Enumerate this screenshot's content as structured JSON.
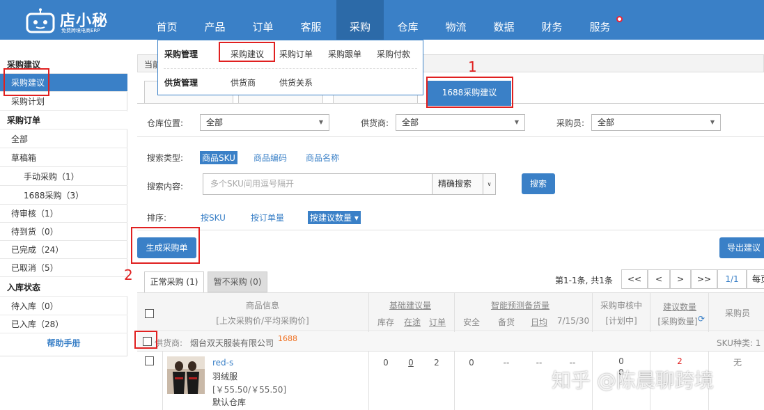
{
  "logo": {
    "brand": "店小秘",
    "tagline": "免费跨境电商ERP"
  },
  "nav": {
    "items": [
      "首页",
      "产品",
      "订单",
      "客服",
      "采购",
      "仓库",
      "物流",
      "数据",
      "财务",
      "服务"
    ],
    "active": "采购"
  },
  "dropdown": {
    "group1_title": "采购管理",
    "group1_items": [
      "采购建议",
      "采购订单",
      "采购跟单",
      "采购付款"
    ],
    "group2_title": "供货管理",
    "group2_items": [
      "供货商",
      "供货关系"
    ]
  },
  "sidebar": {
    "rows": [
      {
        "label": "采购建议",
        "type": "head"
      },
      {
        "label": "采购建议",
        "type": "item",
        "selected": true
      },
      {
        "label": "采购计划",
        "type": "item"
      },
      {
        "label": "采购订单",
        "type": "head"
      },
      {
        "label": "全部",
        "type": "item"
      },
      {
        "label": "草稿箱",
        "type": "item"
      },
      {
        "label": "手动采购（1）",
        "type": "sub"
      },
      {
        "label": "1688采购（3）",
        "type": "sub"
      },
      {
        "label": "待审核（1）",
        "type": "item"
      },
      {
        "label": "待到货（0）",
        "type": "item"
      },
      {
        "label": "已完成（24）",
        "type": "item"
      },
      {
        "label": "已取消（5）",
        "type": "item"
      },
      {
        "label": "入库状态",
        "type": "head"
      },
      {
        "label": "待入库（0）",
        "type": "item"
      },
      {
        "label": "已入库（28）",
        "type": "item"
      },
      {
        "label": "帮助手册",
        "type": "help"
      }
    ]
  },
  "breadcrumb": "当前",
  "tabs": {
    "active_label": "1688采购建议"
  },
  "filters": {
    "warehouse_label": "仓库位置:",
    "warehouse_value": "全部",
    "supplier_label": "供货商:",
    "supplier_value": "全部",
    "buyer_label": "采购员:",
    "buyer_value": "全部"
  },
  "search": {
    "type_label": "搜索类型:",
    "types": [
      "商品SKU",
      "商品编码",
      "商品名称"
    ],
    "active_type": "商品SKU",
    "content_label": "搜索内容:",
    "placeholder": "多个SKU间用逗号隔开",
    "mode": "精确搜索",
    "button": "搜索"
  },
  "sort": {
    "label": "排序:",
    "options": [
      "按SKU",
      "按订单量",
      "按建议数量 ▾"
    ]
  },
  "actions": {
    "generate": "生成采购单",
    "export": "导出建议"
  },
  "list_tabs": {
    "normal": "正常采购 (1)",
    "paused": "暂不采购 (0)"
  },
  "pager": {
    "info": "第1-1条, 共1条",
    "first": "<<",
    "prev": "<",
    "next": ">",
    "last": ">>",
    "page": "1/1",
    "per": "每页"
  },
  "table": {
    "headers": {
      "product": "商品信息",
      "product_sub": "[上次采购价/平均采购价]",
      "base": "基础建议量",
      "stock": "库存",
      "transit": "在途",
      "order": "订单",
      "smart": "智能预测备货量",
      "safe": "安全",
      "backup": "备货",
      "daily": "日均",
      "date": "7/15/30",
      "audit": "采购审核中",
      "audit_sub": "[计划中]",
      "suggest": "建议数量",
      "suggest_sub": "[采购数量]",
      "buyer": "采购员"
    },
    "supplier": {
      "label": "供货商:",
      "name": "烟台双天服装有限公司",
      "tag": "1688",
      "sku_kinds": "SKU种类: 1"
    },
    "row": {
      "sku": "red-s",
      "name": "羽绒服",
      "price": "[￥55.50/￥55.50]",
      "warehouse": "默认仓库",
      "stock": "0",
      "transit": "0",
      "order": "2",
      "safe": "0",
      "backup": "--",
      "daily": "--",
      "date": "--",
      "audit": "0",
      "audit_sub": "0",
      "suggest": "2",
      "buyer": "无"
    }
  },
  "annotations": {
    "num1": "1",
    "num2": "2"
  },
  "watermark": "知乎 @陈晨聊跨境",
  "colors": {
    "primary": "#3a80c7",
    "annotation": "#e02020"
  }
}
